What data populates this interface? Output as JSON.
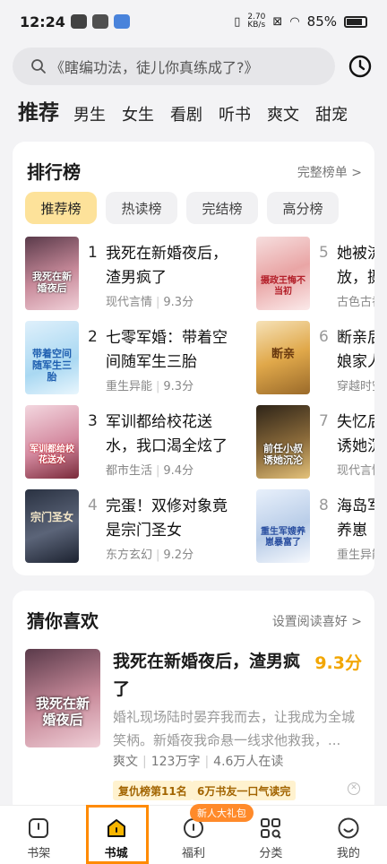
{
  "status": {
    "time": "12:24",
    "net_speed": "2.70\nKB/s",
    "battery": "85%"
  },
  "search": {
    "placeholder": "《瞎编功法，徒儿你真练成了?》"
  },
  "tabs": [
    "推荐",
    "男生",
    "女生",
    "看剧",
    "听书",
    "爽文",
    "甜宠"
  ],
  "ranking": {
    "title": "排行榜",
    "more": "完整榜单 >",
    "pills": [
      "推荐榜",
      "热读榜",
      "完结榜",
      "高分榜"
    ],
    "items": [
      {
        "num": "1",
        "title": "我死在新婚夜后，渣男疯了",
        "genre": "现代言情",
        "score": "9.3分",
        "cover_text": "我死在新婚夜后"
      },
      {
        "num": "2",
        "title": "七零军婚：带着空间随军生三胎",
        "genre": "重生异能",
        "score": "9.3分",
        "cover_text": "带着空间随军生三胎"
      },
      {
        "num": "3",
        "title": "军训都给校花送水，我口渴全炫了",
        "genre": "都市生活",
        "score": "9.4分",
        "cover_text": "军训都给校花送水"
      },
      {
        "num": "4",
        "title": "完蛋！双修对象竟是宗门圣女",
        "genre": "东方玄幻",
        "score": "9.2分",
        "cover_text": "宗门圣女"
      },
      {
        "num": "5",
        "title": "她被流放，摄政王",
        "genre": "古色古香",
        "score": "",
        "cover_text": "摄政王悔不当初"
      },
      {
        "num": "6",
        "title": "断亲后，娘家人",
        "genre": "穿越时空",
        "score": "",
        "cover_text": "断亲"
      },
      {
        "num": "7",
        "title": "失忆后，诱她沉沦",
        "genre": "现代言情",
        "score": "",
        "cover_text": "前任小叔诱她沉沦"
      },
      {
        "num": "8",
        "title": "海岛军嫂养崽",
        "genre": "重生异能",
        "score": "",
        "cover_text": "重生军嫂养崽暴富了"
      }
    ]
  },
  "guess": {
    "title": "猜你喜欢",
    "more": "设置阅读喜好 >",
    "book_title": "我死在新婚夜后，渣男疯了",
    "score": "9.3分",
    "desc": "婚礼现场陆时晏弃我而去，让我成为全城笑柄。新婚夜我命悬一线求他救我，...",
    "category": "爽文",
    "words": "123万字",
    "readers": "4.6万人在读",
    "tag1": "复仇榜第11名",
    "tag2": "6万书友一口气读完",
    "cover_text": "我死在新婚夜后"
  },
  "nav": {
    "items": [
      "书架",
      "书城",
      "福利",
      "分类",
      "我的"
    ],
    "badge": "新人大礼包"
  },
  "colors": {
    "accent": "#f2a600",
    "pill_active": "#fde29a",
    "highlight": "#ff8a00"
  }
}
